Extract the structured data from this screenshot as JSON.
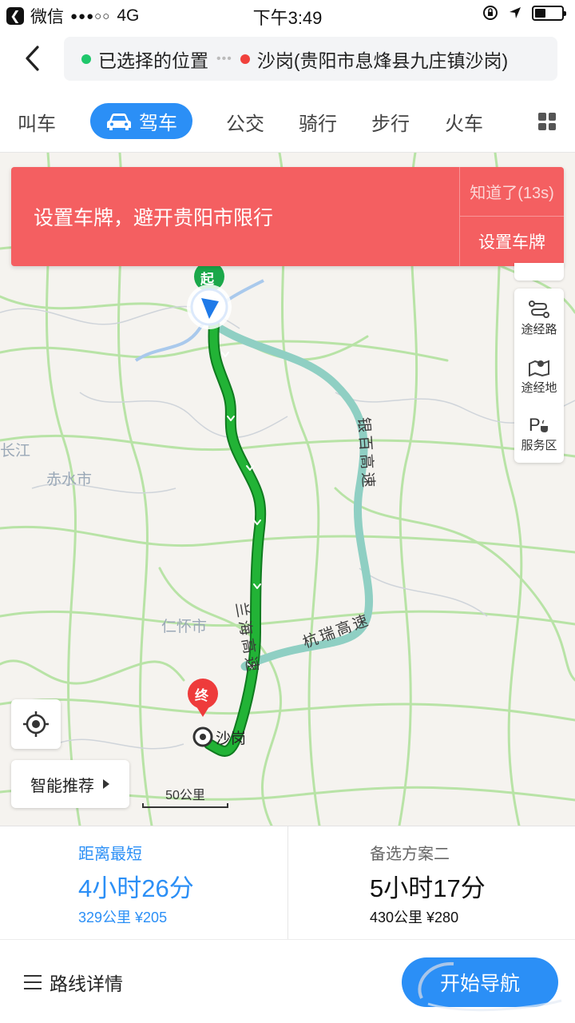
{
  "status_bar": {
    "app": "微信",
    "network": "4G",
    "time": "下午3:49"
  },
  "header": {
    "origin": "已选择的位置",
    "destination": "沙岗(贵阳市息烽县九庄镇沙岗)"
  },
  "tabs": {
    "items": [
      "叫车",
      "驾车",
      "公交",
      "骑行",
      "步行",
      "火车"
    ],
    "active": "驾车"
  },
  "banner": {
    "message": "设置车牌，避开贵阳市限行",
    "dismiss": "知道了(13s)",
    "action": "设置车牌"
  },
  "map": {
    "start_marker": "起",
    "end_marker": "终",
    "end_label": "沙岗",
    "places": [
      "赤水市",
      "仁怀市",
      "长江"
    ],
    "roads": [
      "兰海高速",
      "杭瑞高速",
      "银百高速"
    ],
    "scale": "50公里",
    "side_tools": [
      "途经路",
      "途经地",
      "服务区"
    ],
    "smart_button": "智能推荐"
  },
  "routes": [
    {
      "title": "距离最短",
      "duration": "4小时26分",
      "meta": "329公里 ¥205"
    },
    {
      "title": "备选方案二",
      "duration": "5小时17分",
      "meta": "430公里 ¥280"
    }
  ],
  "bottom": {
    "details": "路线详情",
    "start": "开始导航"
  },
  "colors": {
    "accent": "#2b8ff6",
    "banner": "#f45f61",
    "route_primary": "#1e9e2e",
    "route_alt": "#8fcfc3"
  }
}
